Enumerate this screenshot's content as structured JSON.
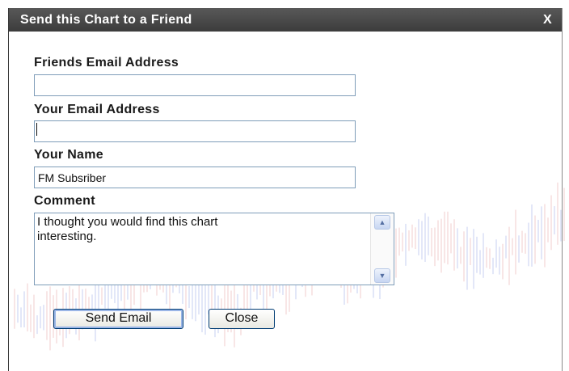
{
  "dialog": {
    "title": "Send this Chart to a Friend",
    "close_label": "X"
  },
  "form": {
    "friend_email": {
      "label": "Friends Email Address",
      "value": ""
    },
    "your_email": {
      "label": "Your Email Address",
      "value": ""
    },
    "your_name": {
      "label": "Your Name",
      "value": "FM Subsriber"
    },
    "comment": {
      "label": "Comment",
      "value": "I thought you would find this chart\ninteresting."
    }
  },
  "buttons": {
    "send_label": "Send Email",
    "close_label": "Close"
  },
  "colors": {
    "titlebar": "#4a4a4a",
    "field_border": "#7f9db9",
    "bg_chart_up": "#7a8fe0",
    "bg_chart_down": "#e08a8a"
  },
  "icons": {
    "scroll_up": "scroll-up-arrow-icon",
    "scroll_down": "scroll-down-arrow-icon"
  }
}
